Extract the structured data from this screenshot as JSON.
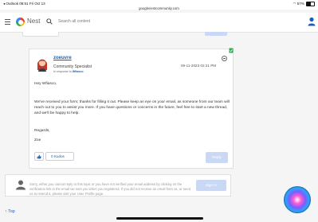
{
  "status_bar": {
    "back_app": "◂ Outlook",
    "time": "08:51",
    "date": "Fri Oct 13",
    "url": "googlenestcommunity.com",
    "battery": "57%",
    "battery_level": 0.57
  },
  "header": {
    "brand": "Nest",
    "search_placeholder": "Search all content"
  },
  "post": {
    "author": "zoeuvre",
    "role": "Community Specialist",
    "in_response_prefix": "In response to",
    "in_response_user": "Wfiasco",
    "date": "09-11-2023 02:21 PM",
    "greeting": "Hey Wfiasco,",
    "paragraph": "We've received your form; thanks for filling it out. Please keep an eye on your email, as someone from our team will reach out to you to assist you more. If you have questions or concerns in the future, feel free to start a new thread, and we'll be happy to help.",
    "signoff": "Regards,",
    "signature": "Zoe",
    "kudos_label": "0 Kudos",
    "reply_label": "Reply"
  },
  "notice": {
    "text": "Sorry, either you cannot reply to this topic or you have not verified your email address by clicking on the verification link in the email we sent you when you registered. If you did not receive an email from us, or need us to resend it, please visit your User Profile page.",
    "sign_in_label": "Sign In"
  },
  "footer": {
    "top_label": "Top"
  }
}
